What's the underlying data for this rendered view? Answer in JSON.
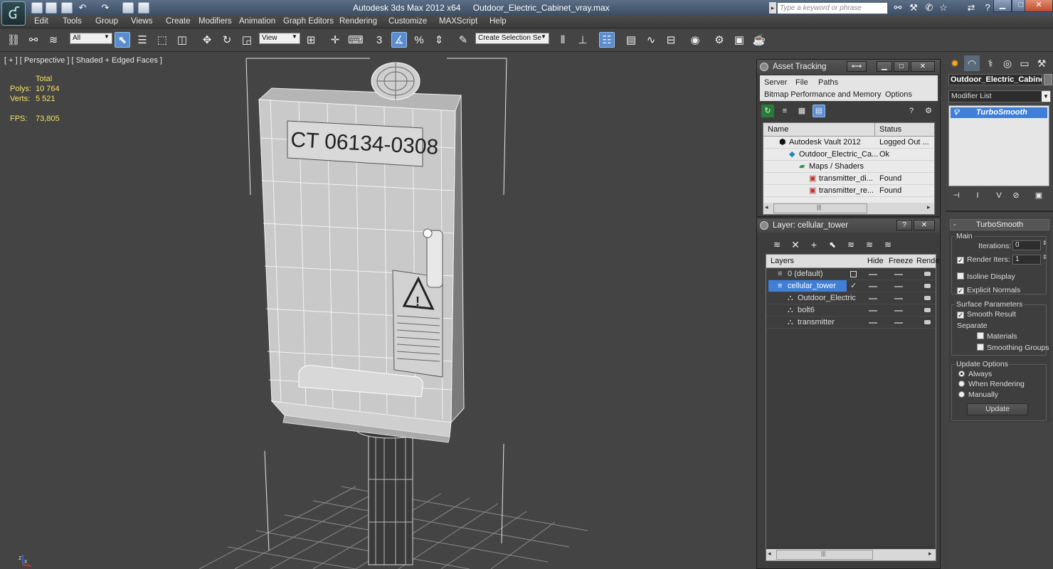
{
  "app": {
    "title": "Autodesk 3ds Max  2012 x64",
    "file": "Outdoor_Electric_Cabinet_vray.max",
    "search_placeholder": "Type a keyword or phrase"
  },
  "menu": [
    "Edit",
    "Tools",
    "Group",
    "Views",
    "Create",
    "Modifiers",
    "Animation",
    "Graph Editors",
    "Rendering",
    "Customize",
    "MAXScript",
    "Help"
  ],
  "toolbar": {
    "selection_filter": "All",
    "ref_coord": "View",
    "named_selection": "Create Selection Se",
    "snap_label": "3"
  },
  "viewport": {
    "label": "[ + ] [ Perspective ] [ Shaded + Edged Faces ]",
    "stats": {
      "total_label": "Total",
      "polys_label": "Polys:",
      "polys": "10 764",
      "verts_label": "Verts:",
      "verts": "5 521",
      "fps_label": "FPS:",
      "fps": "73,805"
    },
    "cabinet_text": "CT 06134-0308",
    "axes": [
      "z",
      "x"
    ]
  },
  "asset_tracking": {
    "title": "Asset Tracking",
    "menu_row1": [
      "Server",
      "File",
      "Paths"
    ],
    "menu_row2": [
      "Bitmap Performance and Memory",
      "Options"
    ],
    "columns": [
      "Name",
      "Status"
    ],
    "rows": [
      {
        "name": "Autodesk Vault 2012",
        "status": "Logged Out ..."
      },
      {
        "name": "Outdoor_Electric_Ca...",
        "status": "Ok"
      },
      {
        "name": "Maps / Shaders",
        "status": ""
      },
      {
        "name": "transmitter_di...",
        "status": "Found"
      },
      {
        "name": "transmitter_re...",
        "status": "Found"
      }
    ],
    "scroll_grip": "|||"
  },
  "layer_panel": {
    "title": "Layer: cellular_tower",
    "columns": [
      "Layers",
      "Hide",
      "Freeze",
      "Rende"
    ],
    "rows": [
      {
        "name": "0 (default)"
      },
      {
        "name": "cellular_tower"
      },
      {
        "name": "Outdoor_Electric"
      },
      {
        "name": "bolt6"
      },
      {
        "name": "transmitter"
      }
    ],
    "scroll_grip": "|||"
  },
  "command_panel": {
    "object_name": "Outdoor_Electric_Cabinet",
    "modifier_list": "Modifier List",
    "modifier": "TurboSmooth",
    "rollout_title": "TurboSmooth",
    "main_label": "Main",
    "iterations_label": "Iterations:",
    "iterations": "0",
    "render_iters_label": "Render Iters:",
    "render_iters": "1",
    "isoline_label": "Isoline Display",
    "explicit_label": "Explicit Normals",
    "surface_label": "Surface Parameters",
    "smooth_result_label": "Smooth Result",
    "separate_label": "Separate",
    "materials_label": "Materials",
    "smoothing_label": "Smoothing Groups",
    "update_options_label": "Update Options",
    "always_label": "Always",
    "when_rendering_label": "When Rendering",
    "manually_label": "Manually",
    "update_button": "Update"
  },
  "colors": {
    "selection_blue": "#3f7fd6",
    "stat_yellow": "#f3e45c",
    "viewport_bg": "#444444"
  }
}
